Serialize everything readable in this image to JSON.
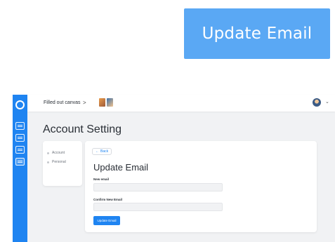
{
  "callout": {
    "text": "Update Email"
  },
  "topbar": {
    "breadcrumb": "Filled out canvas",
    "separator": ">"
  },
  "page": {
    "title": "Account Setting"
  },
  "settings_nav": {
    "items": [
      {
        "label": "Account"
      },
      {
        "label": "Personal"
      }
    ]
  },
  "form": {
    "back_label": "Back",
    "heading": "Update Email",
    "new_email_label": "New email",
    "new_email_value": "",
    "confirm_label": "Confirm New Email",
    "confirm_value": "",
    "submit_label": "Update Email"
  },
  "colors": {
    "accent": "#1f84f1",
    "callout": "#5aa8f4"
  },
  "icons": {
    "rail": [
      "app-logo-icon",
      "canvas-icon",
      "board-icon",
      "clipboard-icon",
      "message-icon"
    ]
  }
}
